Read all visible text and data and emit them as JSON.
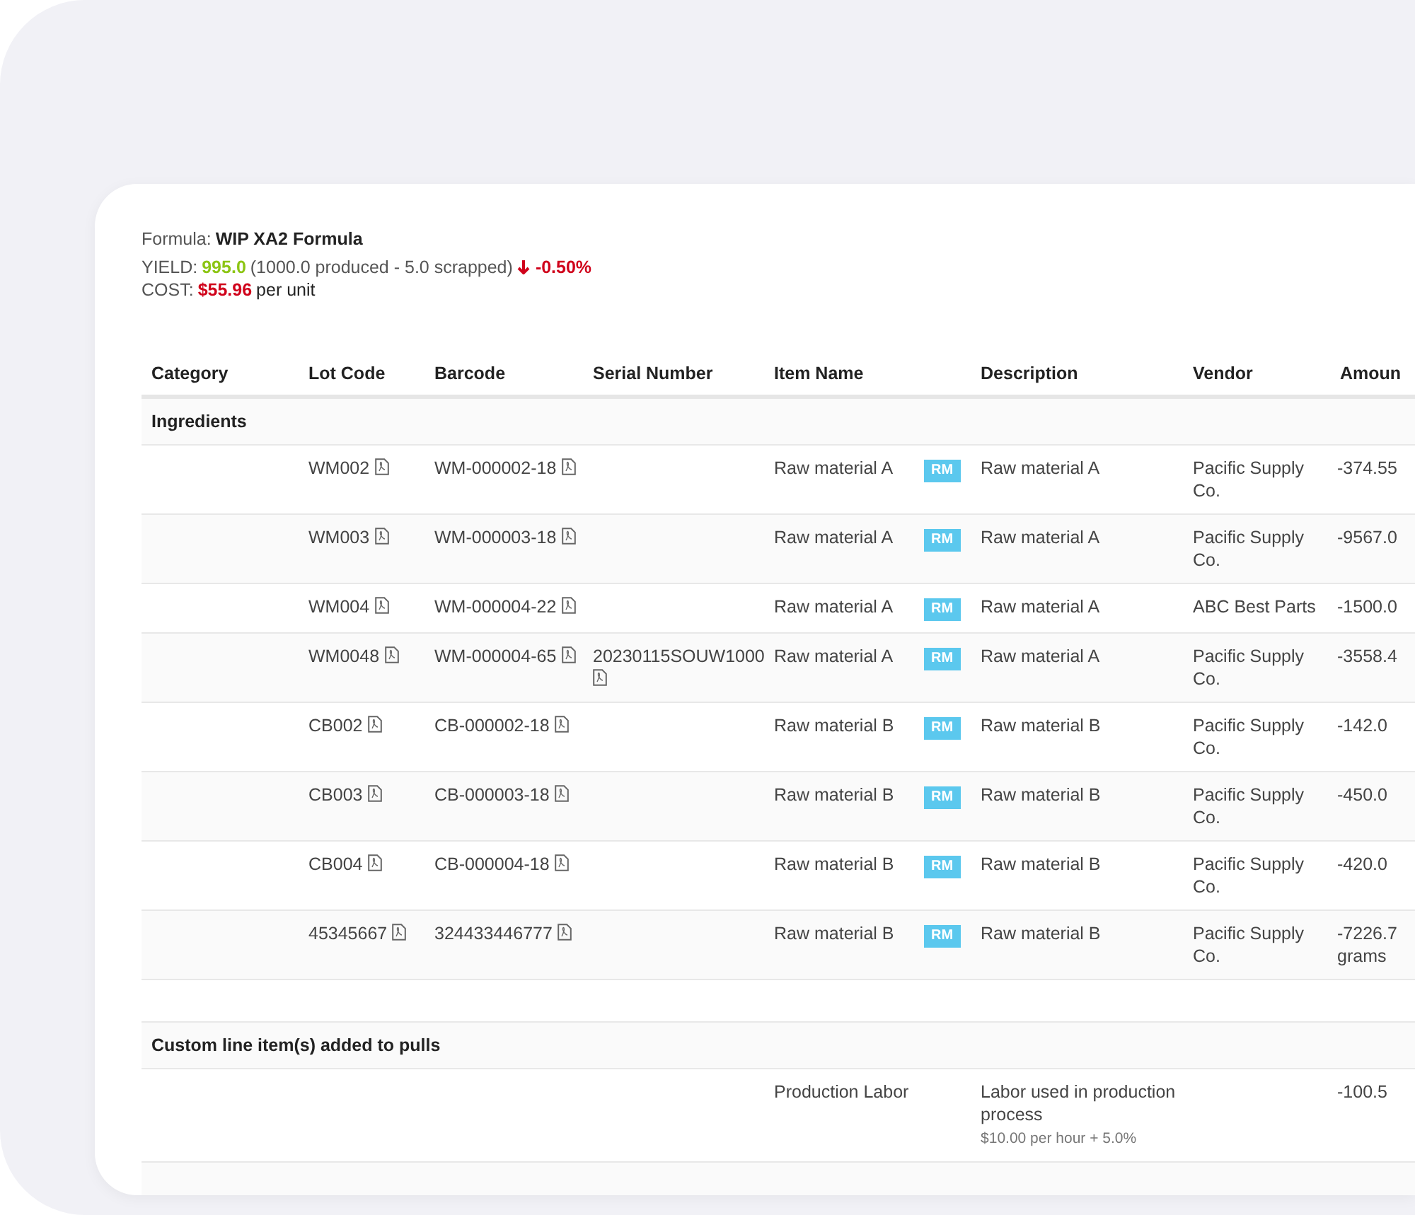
{
  "formula": {
    "label": "Formula:",
    "name": "WIP XA2 Formula"
  },
  "yield": {
    "label": "YIELD:",
    "value": "995.0",
    "detail": "(1000.0 produced - 5.0 scrapped)",
    "down": true,
    "change": "-0.50%"
  },
  "cost": {
    "label": "COST:",
    "value": "$55.96",
    "unit": "per unit"
  },
  "table": {
    "columns": [
      "Category",
      "Lot Code",
      "Barcode",
      "Serial Number",
      "Item Name",
      "Description",
      "Vendor",
      "Amoun"
    ],
    "sections": [
      {
        "title": "Ingredients",
        "rows": [
          {
            "lot_code": "WM002",
            "barcode": "WM-000002-18",
            "item_name": "Raw material A",
            "tag": "RM",
            "description": "Raw material A",
            "vendor": "Pacific Supply Co.",
            "amount": "-374.55"
          },
          {
            "lot_code": "WM003",
            "barcode": "WM-000003-18",
            "item_name": "Raw material A",
            "tag": "RM",
            "description": "Raw material A",
            "vendor": "Pacific Supply Co.",
            "amount": "-9567.0"
          },
          {
            "lot_code": "WM004",
            "barcode": "WM-000004-22",
            "item_name": "Raw material A",
            "tag": "RM",
            "description": "Raw material A",
            "vendor": "ABC Best Parts",
            "amount": "-1500.0"
          },
          {
            "lot_code": "WM0048",
            "barcode": "WM-000004-65",
            "serial_number": "20230115SOUW1000",
            "item_name": "Raw material A",
            "tag": "RM",
            "description": "Raw material A",
            "vendor": "Pacific Supply Co.",
            "amount": "-3558.4"
          },
          {
            "lot_code": "CB002",
            "barcode": "CB-000002-18",
            "item_name": "Raw material B",
            "tag": "RM",
            "description": "Raw material B",
            "vendor": "Pacific Supply Co.",
            "amount": "-142.0"
          },
          {
            "lot_code": "CB003",
            "barcode": "CB-000003-18",
            "item_name": "Raw material B",
            "tag": "RM",
            "description": "Raw material B",
            "vendor": "Pacific Supply Co.",
            "amount": "-450.0"
          },
          {
            "lot_code": "CB004",
            "barcode": "CB-000004-18",
            "item_name": "Raw material B",
            "tag": "RM",
            "description": "Raw material B",
            "vendor": "Pacific Supply Co.",
            "amount": "-420.0"
          },
          {
            "lot_code": "45345667",
            "barcode": "324433446777",
            "item_name": "Raw material B",
            "tag": "RM",
            "description": "Raw material B",
            "vendor": "Pacific Supply Co.",
            "amount": "-7226.7 grams"
          }
        ]
      },
      {
        "title": "Custom line item(s) added to pulls",
        "rows": [
          {
            "item_name": "Production Labor",
            "description": "Labor used in production process",
            "note": "$10.00 per hour + 5.0%",
            "amount": "-100.5"
          }
        ]
      }
    ]
  }
}
